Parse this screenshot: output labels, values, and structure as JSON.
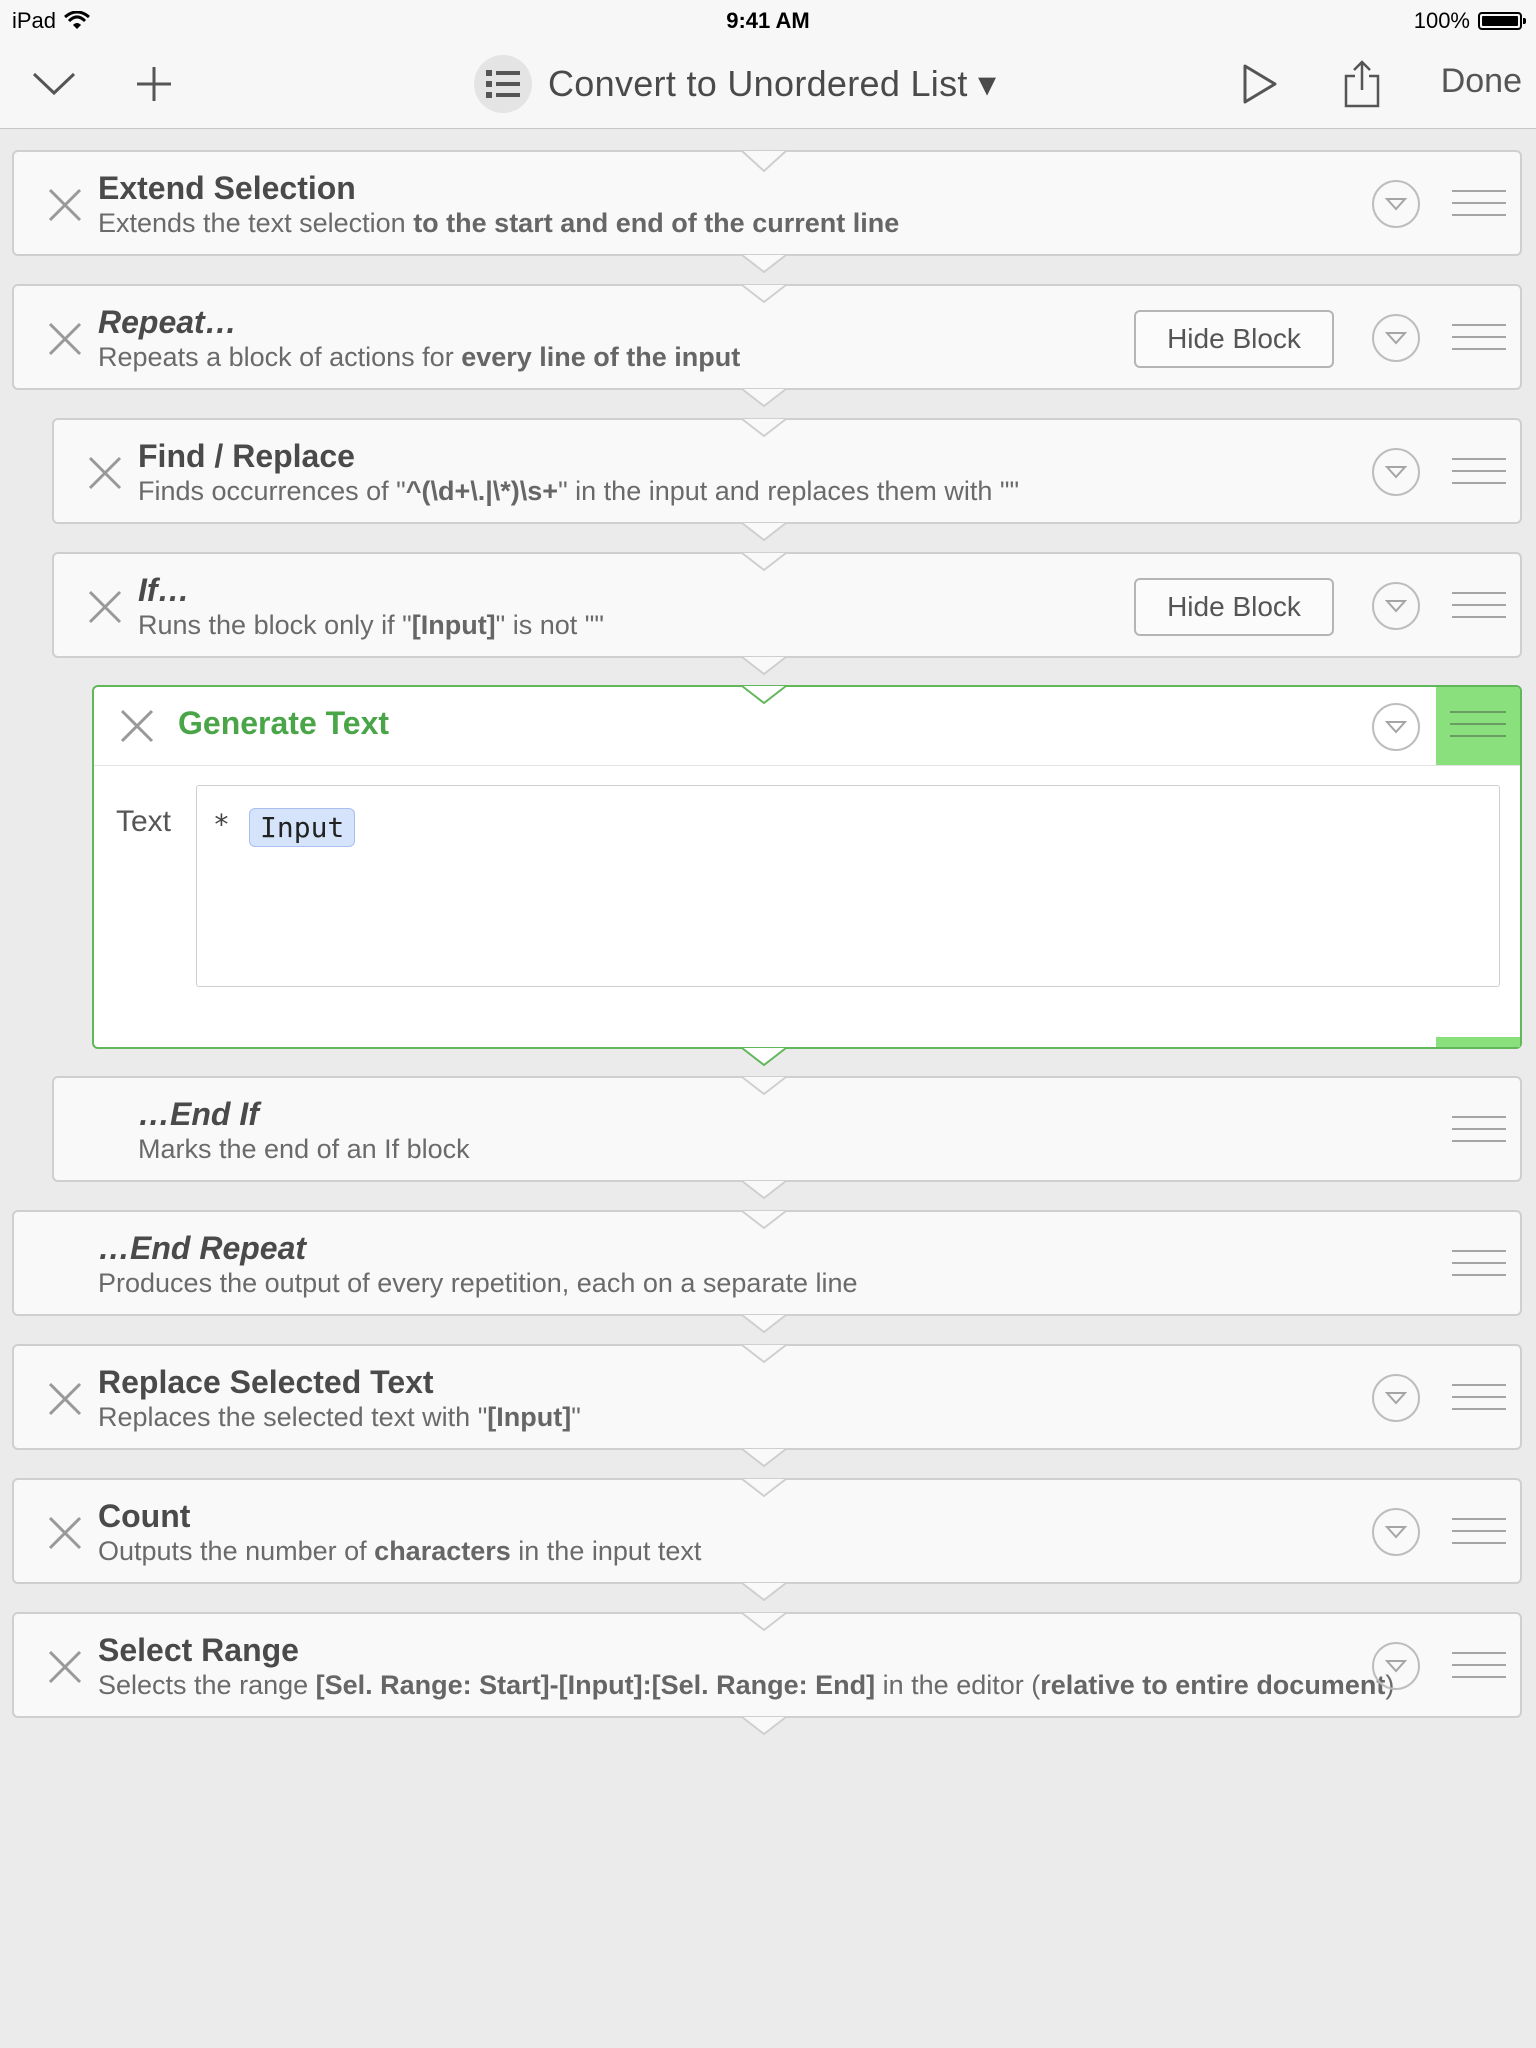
{
  "status_bar": {
    "device": "iPad",
    "time": "9:41 AM",
    "battery": "100%"
  },
  "nav": {
    "title": "Convert to Unordered List ▾",
    "done": "Done"
  },
  "blocks": [
    {
      "title": "Extend Selection",
      "sub_plain": "Extends the text selection ",
      "sub_bold": "to the start and end of the current line"
    },
    {
      "title": "Repeat…",
      "sub_plain": "Repeats a block of actions for ",
      "sub_bold": "every line of the input",
      "hide_block": "Hide Block"
    },
    {
      "title": "Find / Replace",
      "sub_1": "Finds occurrences of \"",
      "sub_2": "^(\\d+\\.|\\*)\\s+",
      "sub_3": "\" in the input and replaces them with \"\""
    },
    {
      "title": "If…",
      "sub_1": "Runs the block only if \"",
      "sub_2": "[Input]",
      "sub_3": "\" is not \"\"",
      "hide_block": "Hide Block"
    },
    {
      "title": "Generate Text",
      "field_label": "Text",
      "field_prefix": "*",
      "field_token": "Input"
    },
    {
      "title": "…End If",
      "sub": "Marks the end of an If block"
    },
    {
      "title": "…End Repeat",
      "sub": "Produces the output of every repetition, each on a separate line"
    },
    {
      "title": "Replace Selected Text",
      "sub_1": "Replaces the selected text with \"",
      "sub_2": "[Input]",
      "sub_3": "\""
    },
    {
      "title": "Count",
      "sub_1": "Outputs the number of ",
      "sub_2": "characters",
      "sub_3": " in the input text"
    },
    {
      "title": "Select Range",
      "sub_1": "Selects the range ",
      "sub_2": "[Sel. Range: Start]-[Input]:[Sel. Range: End]",
      "sub_3": " in the editor (",
      "sub_4": "relative to entire document",
      "sub_5": ")"
    }
  ],
  "colors": {
    "accent_green": "#4aa548",
    "handle_green": "#8be07e",
    "token_blue": "#d6e4fb"
  }
}
